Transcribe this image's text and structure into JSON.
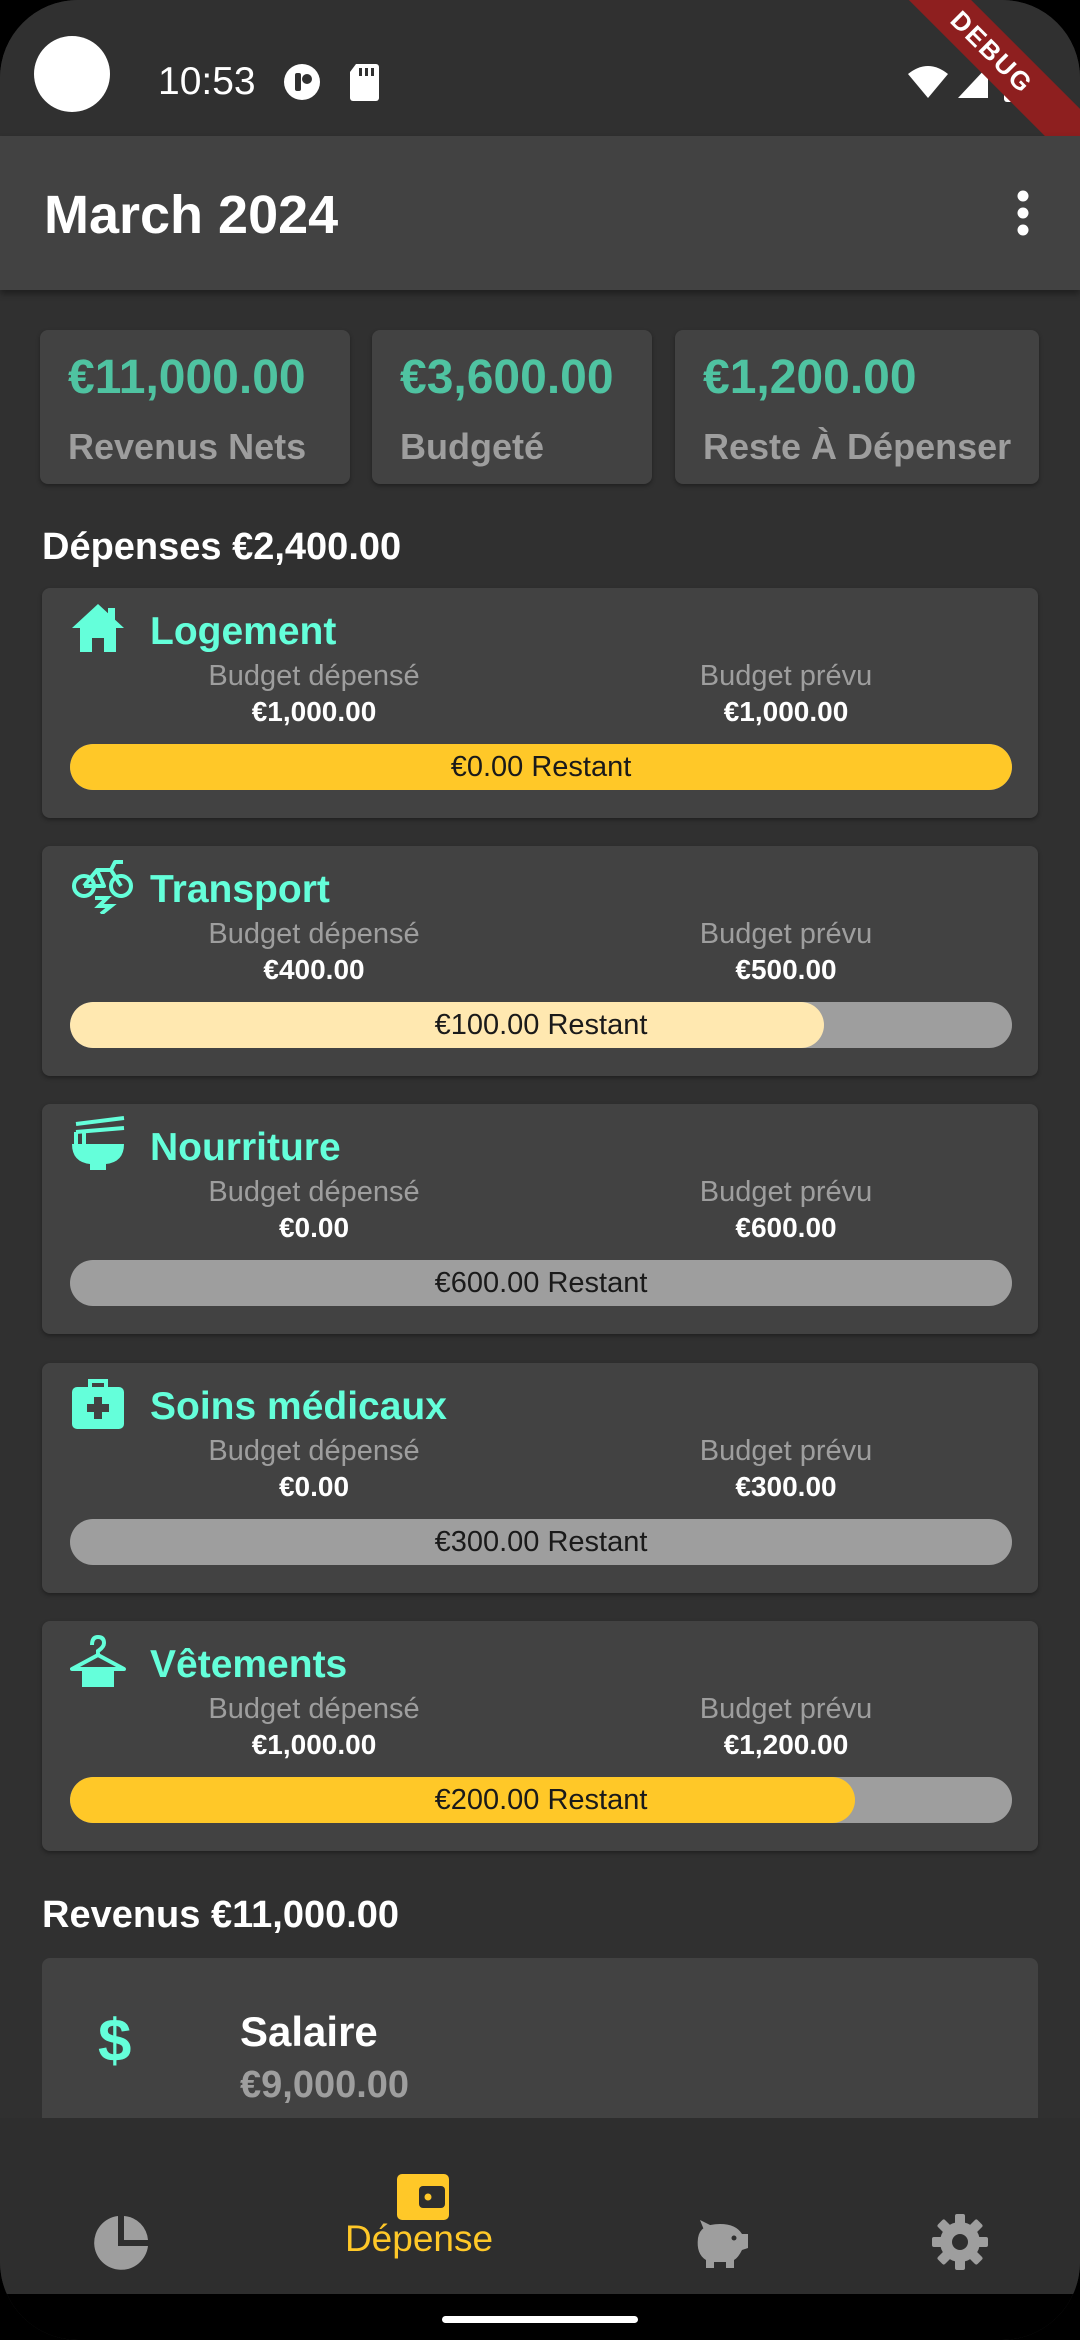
{
  "status_bar": {
    "time": "10:53",
    "debug_banner": "DEBUG"
  },
  "app_bar": {
    "title": "March 2024",
    "menu_icon": "more-vert-icon"
  },
  "summary": [
    {
      "amount": "€11,000.00",
      "label": "Revenus Nets"
    },
    {
      "amount": "€3,600.00",
      "label": "Budgeté"
    },
    {
      "amount": "€1,200.00",
      "label": "Reste À Dépenser"
    }
  ],
  "expenses_section": {
    "title": "Dépenses €2,400.00"
  },
  "expenses": [
    {
      "name": "Logement",
      "icon": "house-icon",
      "spent_label": "Budget dépensé",
      "spent": "€1,000.00",
      "planned_label": "Budget prévu",
      "planned": "€1,000.00",
      "remaining": "€0.00 Restant",
      "progress": 1.0,
      "color": "#ffc828"
    },
    {
      "name": "Transport",
      "icon": "bike-icon",
      "spent_label": "Budget dépensé",
      "spent": "€400.00",
      "planned_label": "Budget prévu",
      "planned": "€500.00",
      "remaining": "€100.00 Restant",
      "progress": 0.8,
      "color": "#ffe8b0"
    },
    {
      "name": "Nourriture",
      "icon": "noodle-bowl-icon",
      "spent_label": "Budget dépensé",
      "spent": "€0.00",
      "planned_label": "Budget prévu",
      "planned": "€600.00",
      "remaining": "€600.00 Restant",
      "progress": 0.0,
      "color": "#ffc828"
    },
    {
      "name": "Soins médicaux",
      "icon": "medical-kit-icon",
      "spent_label": "Budget dépensé",
      "spent": "€0.00",
      "planned_label": "Budget prévu",
      "planned": "€300.00",
      "remaining": "€300.00 Restant",
      "progress": 0.0,
      "color": "#ffc828"
    },
    {
      "name": "Vêtements",
      "icon": "hanger-icon",
      "spent_label": "Budget dépensé",
      "spent": "€1,000.00",
      "planned_label": "Budget prévu",
      "planned": "€1,200.00",
      "remaining": "€200.00 Restant",
      "progress": 0.833,
      "color": "#ffc828"
    }
  ],
  "income_section": {
    "title": "Revenus €11,000.00"
  },
  "income": [
    {
      "name": "Salaire",
      "amount": "€9,000.00",
      "icon": "dollar-icon"
    }
  ],
  "bottom_nav": {
    "items": [
      {
        "icon": "pie-chart-icon",
        "label": ""
      },
      {
        "icon": "wallet-icon",
        "label": "Dépense",
        "active": true
      },
      {
        "icon": "piggy-bank-icon",
        "label": ""
      },
      {
        "icon": "gear-icon",
        "label": ""
      }
    ]
  },
  "colors": {
    "accent": "#64ffda",
    "summary_amount": "#4fc3a1",
    "active_nav": "#ffc828",
    "card": "#424242",
    "background": "#303030"
  }
}
